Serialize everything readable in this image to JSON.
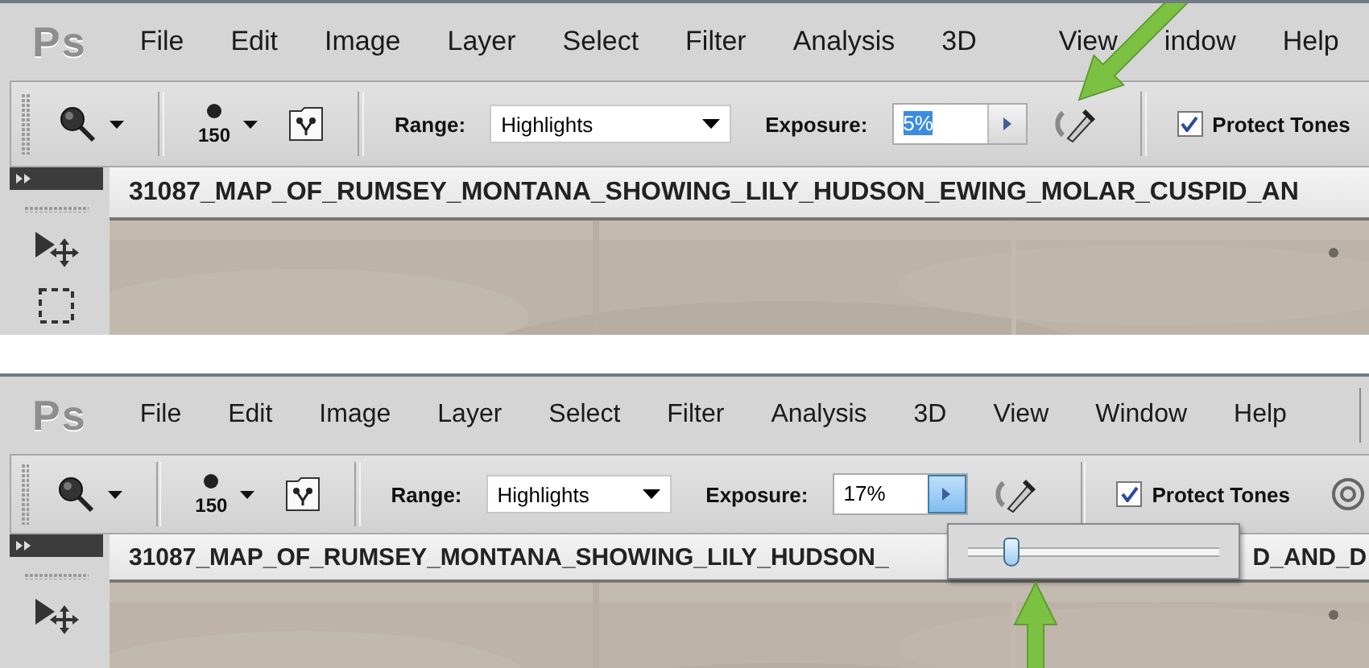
{
  "panels": [
    {
      "logo": "Ps",
      "menu": [
        "File",
        "Edit",
        "Image",
        "Layer",
        "Select",
        "Filter",
        "Analysis",
        "3D",
        "View",
        "indow",
        "Help"
      ],
      "toolbar": {
        "brush_size": "150",
        "range_label": "Range:",
        "range_value": "Highlights",
        "exposure_label": "Exposure:",
        "exposure_value": "5%",
        "value_selected": true,
        "slider_open": false,
        "protect_tones": {
          "label": "Protect Tones",
          "checked": true
        }
      },
      "tools": [
        {
          "kind": "move"
        },
        {
          "kind": "marquee"
        }
      ],
      "document_title": [
        "31087_MAP_OF_RUMSEY_MONTANA_SHOWING_LILY_HUDSON_EWING_MOLAR_CUSPID_AN"
      ],
      "arrow": {
        "kind": "diagonal"
      }
    },
    {
      "logo": "Ps",
      "menu": [
        "File",
        "Edit",
        "Image",
        "Layer",
        "Select",
        "Filter",
        "Analysis",
        "3D",
        "View",
        "Window",
        "Help"
      ],
      "toolbar": {
        "brush_size": "150",
        "range_label": "Range:",
        "range_value": "Highlights",
        "exposure_label": "Exposure:",
        "exposure_value": "17%",
        "value_selected": false,
        "slider_open": true,
        "level": 0.17,
        "protect_tones": {
          "label": "Protect Tones",
          "checked": true
        },
        "pressure_button": true
      },
      "tools": [
        {
          "kind": "move"
        }
      ],
      "document_title": [
        "31087_MAP_OF_RUMSEY_MONTANA_SHOWING_LILY_HUDSON_",
        "D_AND_D"
      ],
      "arrow": {
        "kind": "vertical"
      }
    }
  ]
}
